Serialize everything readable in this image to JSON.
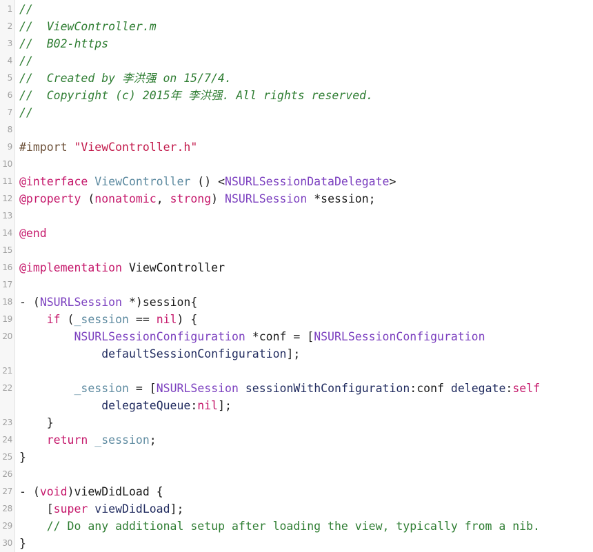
{
  "editor": {
    "language": "objective-c",
    "filename": "ViewController.m",
    "project": "B02-https",
    "author": "李洪强",
    "created": "15/7/4.",
    "copyright_year": "2015年",
    "background_color": "#ffffff",
    "gutter_background_color": "#f7f7f7",
    "gutter_text_color": "#a0a0a0",
    "total_lines": 30,
    "palette": {
      "comment": "#2e7d32",
      "preprocessor": "#6b4f37",
      "string": "#c2184a",
      "keyword": "#c5186b",
      "class_reference": "#5d8aa0",
      "type": "#7b3fbf",
      "message_selector": "#1f2a5e",
      "plain": "#1a1a1a"
    }
  },
  "rows": [
    {
      "num": "1",
      "tokens": [
        {
          "c": "t-comment",
          "t": "//"
        }
      ]
    },
    {
      "num": "2",
      "tokens": [
        {
          "c": "t-comment",
          "t": "//  ViewController.m"
        }
      ]
    },
    {
      "num": "3",
      "tokens": [
        {
          "c": "t-comment",
          "t": "//  B02-https"
        }
      ]
    },
    {
      "num": "4",
      "tokens": [
        {
          "c": "t-comment",
          "t": "//"
        }
      ]
    },
    {
      "num": "5",
      "tokens": [
        {
          "c": "t-comment",
          "t": "//  Created by 李洪强 on 15/7/4."
        }
      ]
    },
    {
      "num": "6",
      "tokens": [
        {
          "c": "t-comment",
          "t": "//  Copyright (c) 2015年 李洪强. All rights reserved."
        }
      ]
    },
    {
      "num": "7",
      "tokens": [
        {
          "c": "t-comment",
          "t": "//"
        }
      ]
    },
    {
      "num": "8",
      "tokens": []
    },
    {
      "num": "9",
      "tokens": [
        {
          "c": "t-pre",
          "t": "#import "
        },
        {
          "c": "t-string",
          "t": "\"ViewController.h\""
        }
      ]
    },
    {
      "num": "10",
      "tokens": []
    },
    {
      "num": "11",
      "tokens": [
        {
          "c": "t-keyword",
          "t": "@interface"
        },
        {
          "c": "t-plain",
          "t": " "
        },
        {
          "c": "t-classref",
          "t": "ViewController"
        },
        {
          "c": "t-plain",
          "t": " () <"
        },
        {
          "c": "t-type",
          "t": "NSURLSessionDataDelegate"
        },
        {
          "c": "t-plain",
          "t": ">"
        }
      ]
    },
    {
      "num": "12",
      "tokens": [
        {
          "c": "t-keyword",
          "t": "@property"
        },
        {
          "c": "t-plain",
          "t": " ("
        },
        {
          "c": "t-keyword",
          "t": "nonatomic"
        },
        {
          "c": "t-plain",
          "t": ", "
        },
        {
          "c": "t-keyword",
          "t": "strong"
        },
        {
          "c": "t-plain",
          "t": ") "
        },
        {
          "c": "t-type",
          "t": "NSURLSession"
        },
        {
          "c": "t-plain",
          "t": " *session;"
        }
      ]
    },
    {
      "num": "13",
      "tokens": []
    },
    {
      "num": "14",
      "tokens": [
        {
          "c": "t-keyword",
          "t": "@end"
        }
      ]
    },
    {
      "num": "15",
      "tokens": []
    },
    {
      "num": "16",
      "tokens": [
        {
          "c": "t-keyword",
          "t": "@implementation"
        },
        {
          "c": "t-plain",
          "t": " ViewController"
        }
      ]
    },
    {
      "num": "17",
      "tokens": []
    },
    {
      "num": "18",
      "tokens": [
        {
          "c": "t-plain",
          "t": "- ("
        },
        {
          "c": "t-type",
          "t": "NSURLSession"
        },
        {
          "c": "t-plain",
          "t": " *)session{"
        }
      ]
    },
    {
      "num": "19",
      "tokens": [
        {
          "c": "t-plain",
          "t": "    "
        },
        {
          "c": "t-keyword",
          "t": "if"
        },
        {
          "c": "t-plain",
          "t": " ("
        },
        {
          "c": "t-ivar",
          "t": "_session"
        },
        {
          "c": "t-plain",
          "t": " == "
        },
        {
          "c": "t-keyword",
          "t": "nil"
        },
        {
          "c": "t-plain",
          "t": ") {"
        }
      ]
    },
    {
      "num": "20",
      "tokens": [
        {
          "c": "t-plain",
          "t": "        "
        },
        {
          "c": "t-type",
          "t": "NSURLSessionConfiguration"
        },
        {
          "c": "t-plain",
          "t": " *conf = ["
        },
        {
          "c": "t-type",
          "t": "NSURLSessionConfiguration"
        }
      ]
    },
    {
      "num": "",
      "tokens": [
        {
          "c": "t-plain",
          "t": "            "
        },
        {
          "c": "t-msg",
          "t": "defaultSessionConfiguration"
        },
        {
          "c": "t-plain",
          "t": "];"
        }
      ]
    },
    {
      "num": "21",
      "tokens": []
    },
    {
      "num": "22",
      "tokens": [
        {
          "c": "t-plain",
          "t": "        "
        },
        {
          "c": "t-ivar",
          "t": "_session"
        },
        {
          "c": "t-plain",
          "t": " = ["
        },
        {
          "c": "t-type",
          "t": "NSURLSession"
        },
        {
          "c": "t-plain",
          "t": " "
        },
        {
          "c": "t-msg",
          "t": "sessionWithConfiguration"
        },
        {
          "c": "t-plain",
          "t": ":conf "
        },
        {
          "c": "t-msg",
          "t": "delegate"
        },
        {
          "c": "t-plain",
          "t": ":"
        },
        {
          "c": "t-keyword",
          "t": "self"
        }
      ]
    },
    {
      "num": "",
      "tokens": [
        {
          "c": "t-plain",
          "t": "            "
        },
        {
          "c": "t-msg",
          "t": "delegateQueue"
        },
        {
          "c": "t-plain",
          "t": ":"
        },
        {
          "c": "t-keyword",
          "t": "nil"
        },
        {
          "c": "t-plain",
          "t": "];"
        }
      ]
    },
    {
      "num": "23",
      "tokens": [
        {
          "c": "t-plain",
          "t": "    }"
        }
      ]
    },
    {
      "num": "24",
      "tokens": [
        {
          "c": "t-plain",
          "t": "    "
        },
        {
          "c": "t-keyword",
          "t": "return"
        },
        {
          "c": "t-plain",
          "t": " "
        },
        {
          "c": "t-ivar",
          "t": "_session"
        },
        {
          "c": "t-plain",
          "t": ";"
        }
      ]
    },
    {
      "num": "25",
      "tokens": [
        {
          "c": "t-plain",
          "t": "}"
        }
      ]
    },
    {
      "num": "26",
      "tokens": []
    },
    {
      "num": "27",
      "tokens": [
        {
          "c": "t-plain",
          "t": "- ("
        },
        {
          "c": "t-keyword",
          "t": "void"
        },
        {
          "c": "t-plain",
          "t": ")viewDidLoad {"
        }
      ]
    },
    {
      "num": "28",
      "tokens": [
        {
          "c": "t-plain",
          "t": "    ["
        },
        {
          "c": "t-keyword",
          "t": "super"
        },
        {
          "c": "t-plain",
          "t": " "
        },
        {
          "c": "t-msg",
          "t": "viewDidLoad"
        },
        {
          "c": "t-plain",
          "t": "];"
        }
      ]
    },
    {
      "num": "29",
      "tokens": [
        {
          "c": "t-plain",
          "t": "    "
        },
        {
          "c": "t-comment-plain",
          "t": "// Do any additional setup after loading the view, typically from a nib."
        }
      ]
    },
    {
      "num": "30",
      "tokens": [
        {
          "c": "t-plain",
          "t": "}"
        }
      ]
    }
  ]
}
